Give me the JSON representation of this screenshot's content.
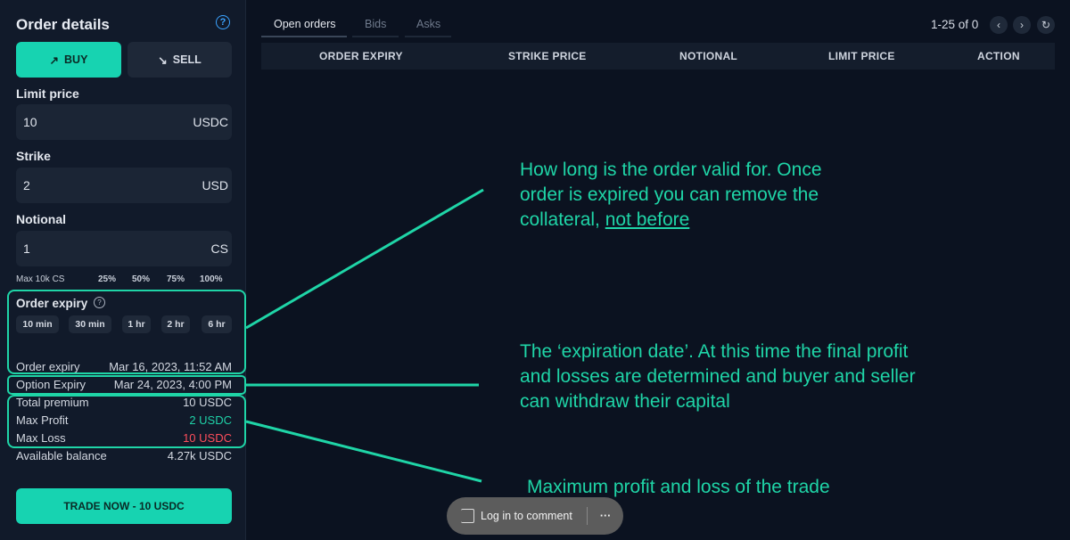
{
  "order": {
    "title": "Order details",
    "buy_label": "BUY",
    "sell_label": "SELL",
    "limit_price": {
      "label": "Limit price",
      "value": "10",
      "unit": "USDC"
    },
    "strike": {
      "label": "Strike",
      "value": "2",
      "unit": "USD"
    },
    "notional": {
      "label": "Notional",
      "value": "1",
      "unit": "CS"
    },
    "max_text": "Max 10k CS",
    "pcts": [
      "25%",
      "50%",
      "75%",
      "100%"
    ],
    "expiry_label": "Order expiry",
    "expiry_chips": [
      "10 min",
      "30 min",
      "1 hr",
      "2 hr",
      "6 hr"
    ],
    "rows": [
      {
        "label": "Order expiry",
        "value": "Mar 16, 2023, 11:52 AM"
      },
      {
        "label": "Option Expiry",
        "value": "Mar 24, 2023, 4:00 PM"
      },
      {
        "label": "Total premium",
        "value": "10 USDC"
      },
      {
        "label": "Max Profit",
        "value": "2 USDC"
      },
      {
        "label": "Max Loss",
        "value": "10 USDC"
      },
      {
        "label": "Available balance",
        "value": "4.27k USDC"
      }
    ],
    "trade_label": "TRADE NOW - 10 USDC"
  },
  "tabs": [
    "Open orders",
    "Bids",
    "Asks"
  ],
  "pager": "1-25 of 0",
  "columns": [
    "ORDER EXPIRY",
    "STRIKE PRICE",
    "NOTIONAL",
    "LIMIT PRICE",
    "ACTION"
  ],
  "annotations": {
    "expiry_note_1": "How long is the order valid for. Once",
    "expiry_note_2": "order is expired you can remove the",
    "expiry_note_3a": "collateral, ",
    "expiry_note_3b": "not before",
    "option_note_1": "The ‘expiration date’. At this time the final profit",
    "option_note_2": "and losses are determined and buyer and seller",
    "option_note_3": "can withdraw their capital",
    "profit_note": "Maximum profit and loss of the trade"
  },
  "comment": {
    "label": "Log in to comment",
    "more": "···"
  },
  "colors": {
    "accent": "#17d3b1",
    "loss": "#ff4e5c",
    "annotation": "#1fd5a7"
  }
}
